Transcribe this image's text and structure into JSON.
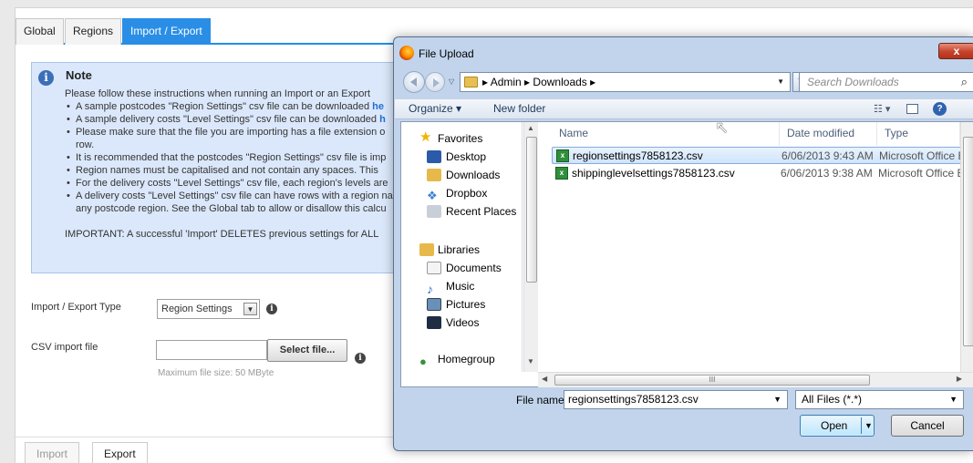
{
  "tabs": [
    "Global",
    "Regions",
    "Import / Export"
  ],
  "note": {
    "title": "Note",
    "intro": "Please follow these instructions when running an Import or an Export",
    "bullets": [
      {
        "text": "A sample postcodes \"Region Settings\" csv file can be downloaded ",
        "link": "he"
      },
      {
        "text": "A sample delivery costs \"Level Settings\" csv file can be downloaded ",
        "link": "h"
      },
      {
        "text": "Please make sure that the file you are importing has a file extension o",
        "cont": "row."
      },
      {
        "text": "It is recommended that the postcodes \"Region Settings\" csv file is imp"
      },
      {
        "text": "Region names must be capitalised and not contain any spaces. This"
      },
      {
        "text": "For the delivery costs \"Level Settings\" csv file, each region's levels are"
      },
      {
        "text": "A delivery costs \"Level Settings\" csv file can have rows with a region na",
        "cont": "any postcode region. See the Global tab to allow or disallow this calcu"
      }
    ],
    "important": "IMPORTANT: A successful 'Import' DELETES previous settings for ALL"
  },
  "form": {
    "type_label": "Import / Export Type",
    "type_value": "Region Settings",
    "csv_label": "CSV import file",
    "select_file": "Select file...",
    "hint": "Maximum file size: 50 MByte"
  },
  "bottom_tabs": [
    "Import",
    "Export"
  ],
  "dialog": {
    "title": "File Upload",
    "close": "x",
    "path": [
      "Admin",
      "Downloads"
    ],
    "search_placeholder": "Search Downloads",
    "toolbar": {
      "organize": "Organize ▾",
      "new_folder": "New folder"
    },
    "nav": {
      "favorites": "Favorites",
      "fav_items": [
        "Desktop",
        "Downloads",
        "Dropbox",
        "Recent Places"
      ],
      "libraries": "Libraries",
      "lib_items": [
        "Documents",
        "Music",
        "Pictures",
        "Videos"
      ],
      "homegroup": "Homegroup"
    },
    "columns": [
      "Name",
      "Date modified",
      "Type"
    ],
    "files": [
      {
        "name": "regionsettings7858123.csv",
        "date": "6/06/2013 9:43 AM",
        "type": "Microsoft Office E"
      },
      {
        "name": "shippinglevelsettings7858123.csv",
        "date": "6/06/2013 9:38 AM",
        "type": "Microsoft Office E"
      }
    ],
    "file_name_label": "File name:",
    "file_name_value": "regionsettings7858123.csv",
    "filter": "All Files (*.*)",
    "open": "Open",
    "cancel": "Cancel"
  }
}
